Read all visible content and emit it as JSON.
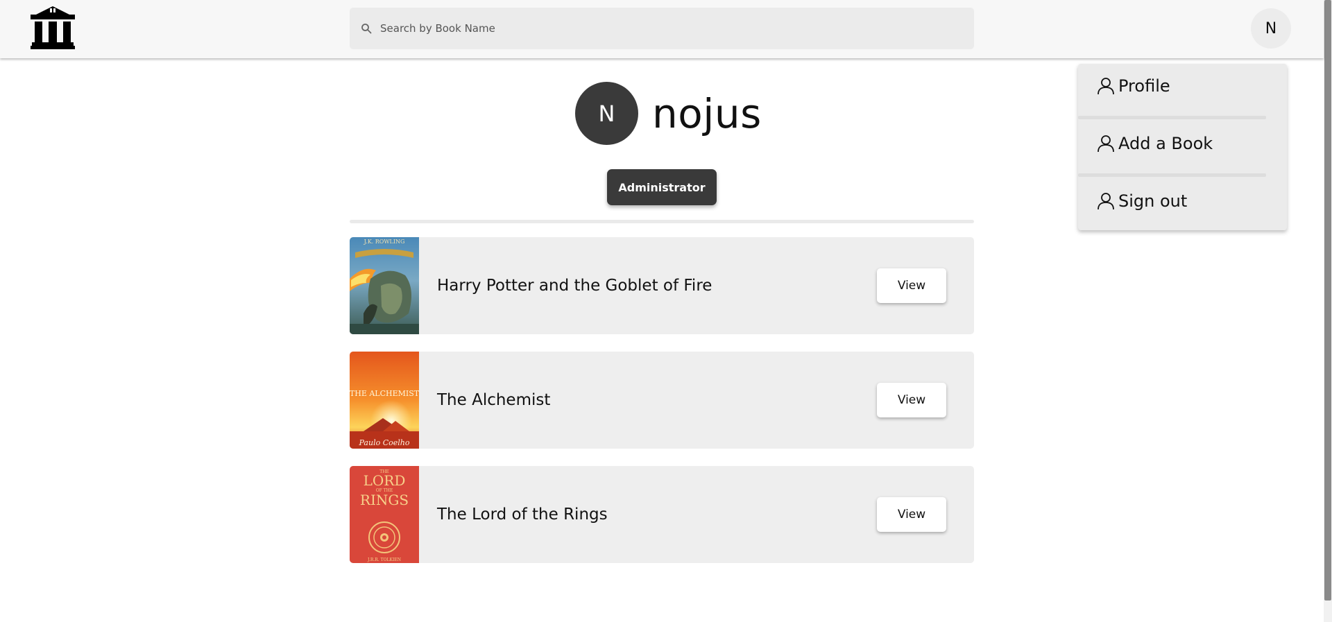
{
  "header": {
    "logo_icon": "museum-icon",
    "search_placeholder": "Search by Book Name",
    "search_icon": "search-icon",
    "user_initial": "N"
  },
  "profile": {
    "initial": "N",
    "username": "nojus",
    "role": "Administrator"
  },
  "books": [
    {
      "title": "Harry Potter and the Goblet of Fire",
      "button": "View",
      "cover_icon": "book-cover-image"
    },
    {
      "title": "The Alchemist",
      "button": "View",
      "cover_icon": "book-cover-image"
    },
    {
      "title": "The Lord of the Rings",
      "button": "View",
      "cover_icon": "book-cover-image"
    }
  ],
  "covers": {
    "hp_author": "J.K. ROWLING",
    "alchemist_title": "THE ALCHEMIST",
    "alchemist_author": "Paulo Coelho",
    "lotr_line1": "THE",
    "lotr_line2": "LORD",
    "lotr_line3": "OF THE",
    "lotr_line4": "RINGS",
    "lotr_author": "J.R.R. TOLKIEN"
  },
  "menu": {
    "items": [
      {
        "label": "Profile",
        "icon": "user-icon"
      },
      {
        "label": "Add a Book",
        "icon": "user-icon"
      },
      {
        "label": "Sign out",
        "icon": "user-icon"
      }
    ]
  },
  "colors": {
    "dark": "#3a3a3a",
    "row_bg": "#eeeeee",
    "header_bg": "#f7f7f7"
  }
}
